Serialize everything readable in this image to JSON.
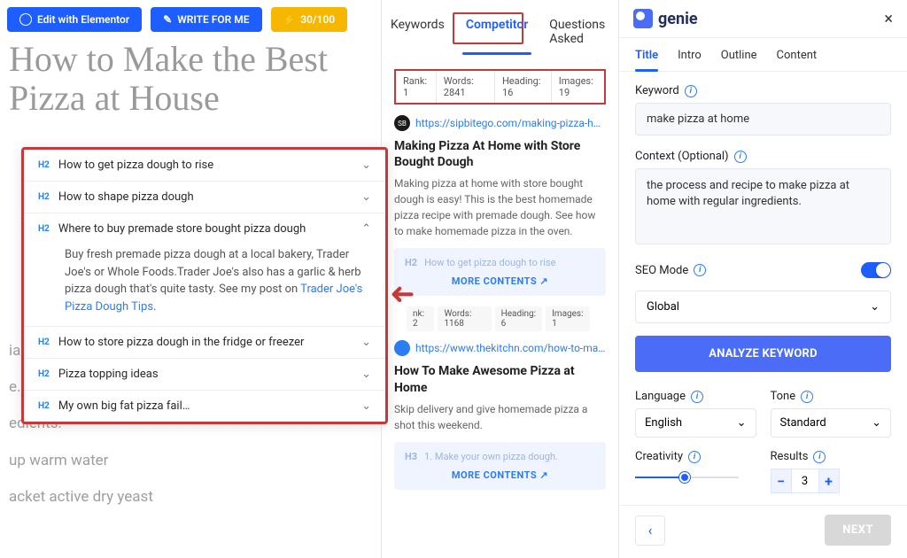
{
  "topbar": {
    "edit_label": "Edit with Elementor",
    "write_label": "WRITE FOR ME",
    "credits_label": "30/100"
  },
  "editor": {
    "title": "How to Make the Best Pizza at House",
    "hidden_text_lines": [
      "ial is",
      "e.",
      "edients:",
      "up warm water",
      "acket active dry yeast"
    ]
  },
  "accordion": {
    "items": [
      {
        "tag": "H2",
        "title": "How to get pizza dough to rise",
        "expanded": false
      },
      {
        "tag": "H2",
        "title": "How to shape pizza dough",
        "expanded": false
      },
      {
        "tag": "H2",
        "title": "Where to buy premade store bought pizza dough",
        "expanded": true,
        "body": "Buy fresh premade pizza dough at a local bakery, Trader Joe's or Whole Foods.Trader Joe's also has a garlic & herb pizza dough that's quite tasty. See my post on ",
        "body_link": "Trader Joe's Pizza Dough Tips",
        "body_after": "."
      },
      {
        "tag": "H2",
        "title": "How to store pizza dough in the fridge or freezer",
        "expanded": false
      },
      {
        "tag": "H2",
        "title": "Pizza topping ideas",
        "expanded": false
      },
      {
        "tag": "H2",
        "title": "My own big fat pizza fail…",
        "expanded": false
      }
    ]
  },
  "mid": {
    "tabs": [
      "Keywords",
      "Competitor",
      "Questions Asked"
    ],
    "active_tab": 1,
    "competitors": [
      {
        "stats": {
          "rank": "Rank: 1",
          "words": "Words: 2841",
          "heading": "Heading: 16",
          "images": "Images: 19"
        },
        "url": "https://sipbitego.com/making-pizza-hom…",
        "title": "Making Pizza At Home with Store Bought Dough",
        "desc": "Making pizza at home with store bought dough is easy! This is the best homemade pizza recipe with premade dough. See how to make homemade pizza in the oven.",
        "expand_h2_tag": "H2",
        "expand_h2": "How to get pizza dough to rise",
        "more": "MORE CONTENTS"
      },
      {
        "stats": {
          "rank": "nk: 2",
          "words": "Words: 1168",
          "heading": "Heading: 6",
          "images": "Images: 1"
        },
        "url": "https://www.thekitchn.com/how-to-make-r…",
        "title": "How To Make Awesome Pizza at Home",
        "desc": "Skip delivery and give homemade pizza a shot this weekend.",
        "expand_h2_tag": "H3",
        "expand_h2": "1. Make your own pizza dough.",
        "more": "MORE CONTENTS"
      }
    ]
  },
  "right": {
    "brand": "genie",
    "tabs": [
      "Title",
      "Intro",
      "Outline",
      "Content"
    ],
    "active_tab": 0,
    "keyword_label": "Keyword",
    "keyword_value": "make pizza at home",
    "context_label": "Context (Optional)",
    "context_value": "the process and recipe to make pizza at home with regular ingredients.",
    "seo_label": "SEO Mode",
    "region_value": "Global",
    "analyze_label": "ANALYZE KEYWORD",
    "language_label": "Language",
    "language_value": "English",
    "tone_label": "Tone",
    "tone_value": "Standard",
    "creativity_label": "Creativity",
    "results_label": "Results",
    "results_value": "3",
    "next_label": "NEXT"
  }
}
